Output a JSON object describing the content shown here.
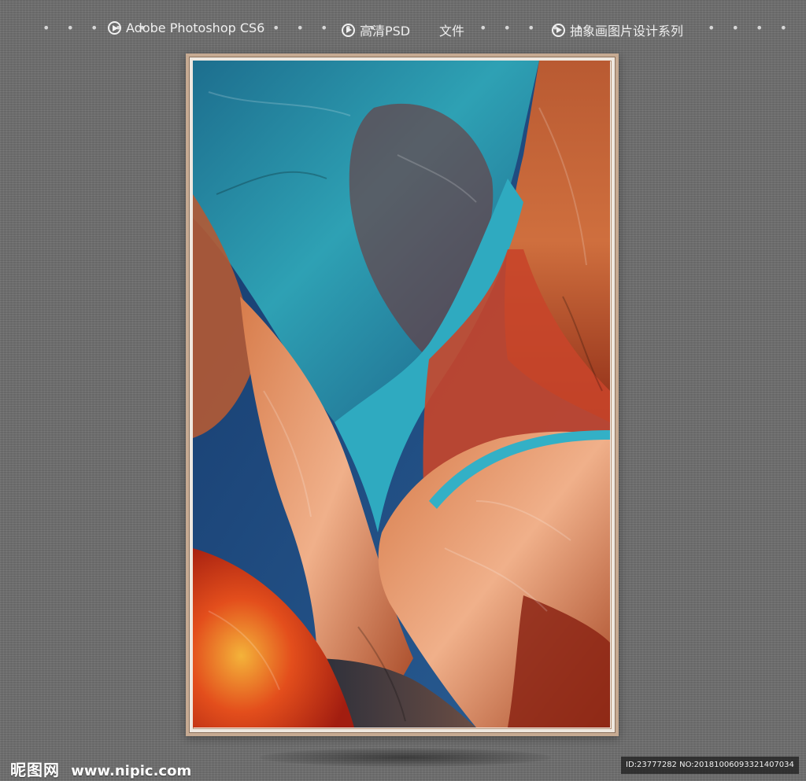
{
  "topbar": {
    "leading_dots": "• • • • •",
    "items": [
      {
        "label": "Adobe Photoshop CS6",
        "icon": "play-circle-icon"
      },
      {
        "label": "高清PSD",
        "icon": "play-circle-icon"
      },
      {
        "label": "文件"
      },
      {
        "label": "抽象画图片设计系列",
        "icon": "play-circle-icon"
      }
    ],
    "separator_dots": "• • • • •",
    "trailing_dots": "• • • •"
  },
  "artwork": {
    "description_colors": {
      "teal": "#2b9fb0",
      "rust": "#c05a2e",
      "peach": "#e4a078",
      "navy": "#183f73",
      "red": "#d23a1c"
    }
  },
  "watermark": {
    "logo_text": "昵图网",
    "site": "www.nipic.com"
  },
  "id_bar": "ID:23777282 NO:20181006093321407034"
}
